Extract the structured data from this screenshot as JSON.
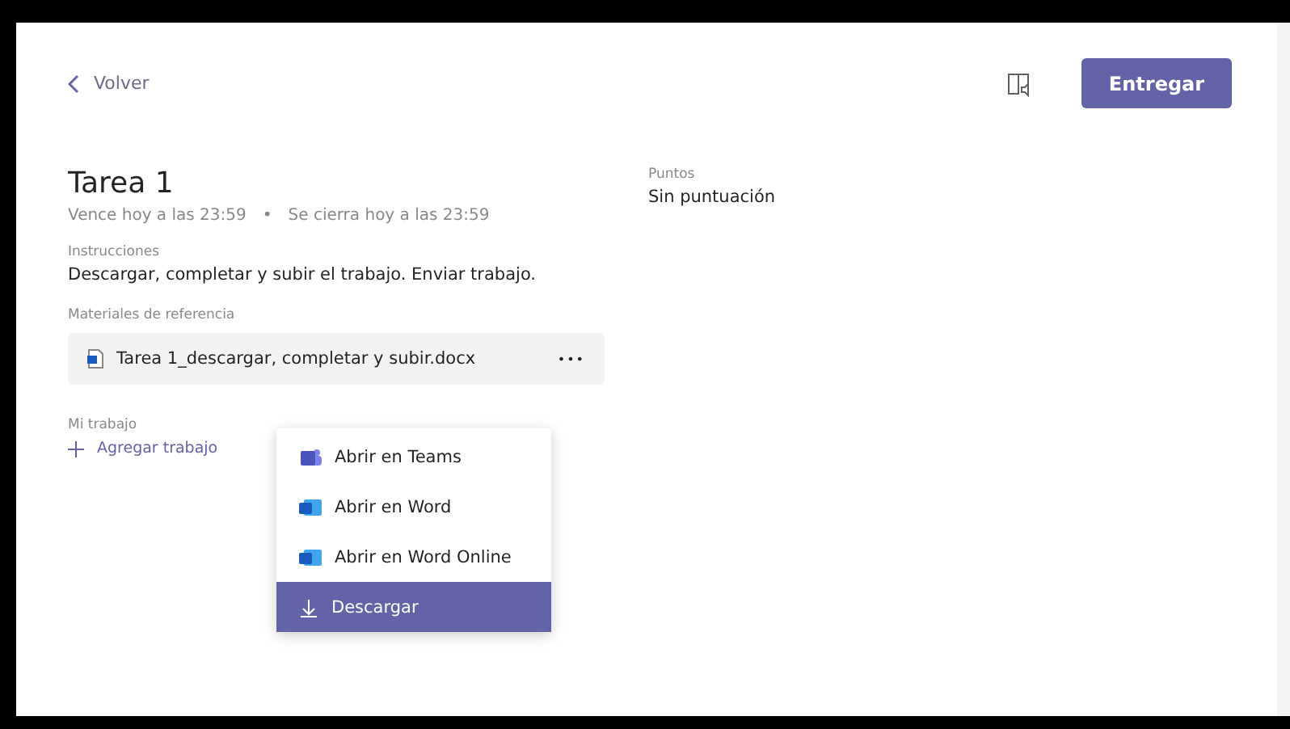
{
  "header": {
    "back": "Volver",
    "submit": "Entregar"
  },
  "assignment": {
    "title": "Tarea 1",
    "due": "Vence hoy a las 23:59",
    "closes": "Se cierra hoy a las 23:59",
    "separator": "•"
  },
  "instructions": {
    "label": "Instrucciones",
    "text": "Descargar, completar y subir el trabajo. Enviar trabajo."
  },
  "materials": {
    "label": "Materiales de referencia",
    "file": "Tarea 1_descargar, completar y subir.docx",
    "more": "•••"
  },
  "menu": [
    {
      "label": "Abrir en Teams",
      "kind": "teams",
      "selected": false
    },
    {
      "label": "Abrir en Word",
      "kind": "word",
      "selected": false
    },
    {
      "label": "Abrir en Word Online",
      "kind": "word",
      "selected": false
    },
    {
      "label": "Descargar",
      "kind": "download",
      "selected": true
    }
  ],
  "my_work": {
    "label": "Mi trabajo",
    "add": "Agregar trabajo"
  },
  "points": {
    "label": "Puntos",
    "value": "Sin puntuación"
  }
}
